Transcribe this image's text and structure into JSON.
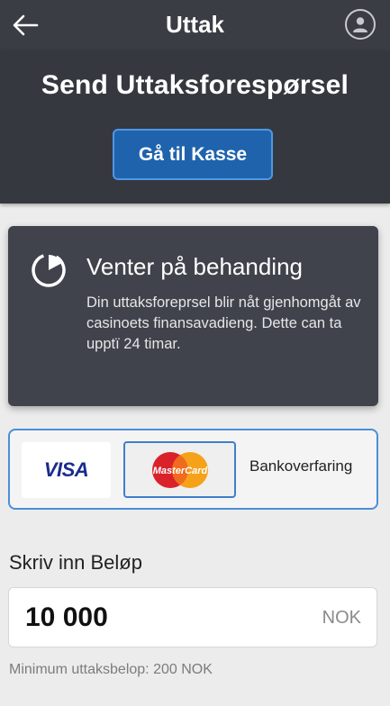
{
  "header": {
    "title": "Uttak",
    "back_icon": "arrow-left-icon",
    "profile_icon": "user-circle-icon"
  },
  "hero": {
    "heading": "Send Uttaksforespørsel",
    "button_label": "Gå til Kasse"
  },
  "status": {
    "icon": "spinner-icon",
    "title": "Venter på behanding",
    "message": "Din uttaksforeprsel blir nåt gjenhomgåt av casinoets finansavadieng. Dette can ta upptï 24 timar."
  },
  "payment": {
    "options": [
      {
        "label": "VISA",
        "selected": false
      },
      {
        "label": "MasterCard",
        "selected": true
      },
      {
        "label": "Bankoverfaring",
        "selected": false
      }
    ]
  },
  "amount": {
    "label": "Skriv inn Beløp",
    "value": "10 000",
    "currency": "NOK",
    "note": "Minimum uttaksbelop: 200 NOK"
  },
  "colors": {
    "header_bg": "#3b3d44",
    "accent": "#1f63ad",
    "card_bg": "#40434b",
    "selection_border": "#4a8fd6"
  }
}
